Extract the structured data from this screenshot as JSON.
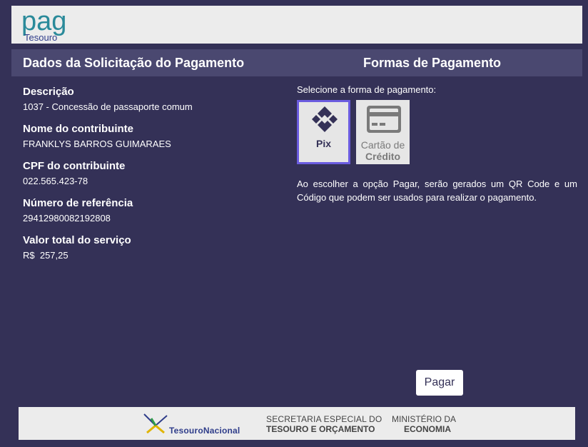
{
  "logo": {
    "text_pag": "pag",
    "text_tesouro": "Tesouro"
  },
  "header": {
    "left_title": "Dados da Solicitação do Pagamento",
    "right_title": "Formas de Pagamento"
  },
  "fields": [
    {
      "label": "Descrição",
      "value": "1037 - Concessão de passaporte comum"
    },
    {
      "label": "Nome do contribuinte",
      "value": "FRANKLYS BARROS GUIMARAES"
    },
    {
      "label": "CPF do contribuinte",
      "value": "022.565.423-78"
    },
    {
      "label": "Número de referência",
      "value": "29412980082192808"
    },
    {
      "label": "Valor total do serviço",
      "value": "R$  257,25"
    }
  ],
  "payment": {
    "select_label": "Selecione a forma de pagamento:",
    "options": [
      {
        "label": "Pix",
        "icon": "pix-icon",
        "selected": true
      },
      {
        "label_line1": "Cartão de",
        "label_line2": "Crédito",
        "icon": "credit-card-icon",
        "selected": false
      }
    ],
    "info_text": "Ao escolher a opção Pagar, serão gerados um QR Code e um Código que podem ser usados para realizar o pagamento.",
    "pay_button": "Pagar"
  },
  "footer": {
    "tesouro_nacional": "TesouroNacional",
    "secretaria_line1": "SECRETARIA ESPECIAL DO",
    "secretaria_line2": "TESOURO E ORÇAMENTO",
    "ministerio_line1": "MINISTÉRIO DA",
    "ministerio_line2": "ECONOMIA"
  },
  "colors": {
    "background": "#343157",
    "header_bar": "#4a4870",
    "accent_selected": "#6b5ce0",
    "pix_icon": "#343157"
  }
}
